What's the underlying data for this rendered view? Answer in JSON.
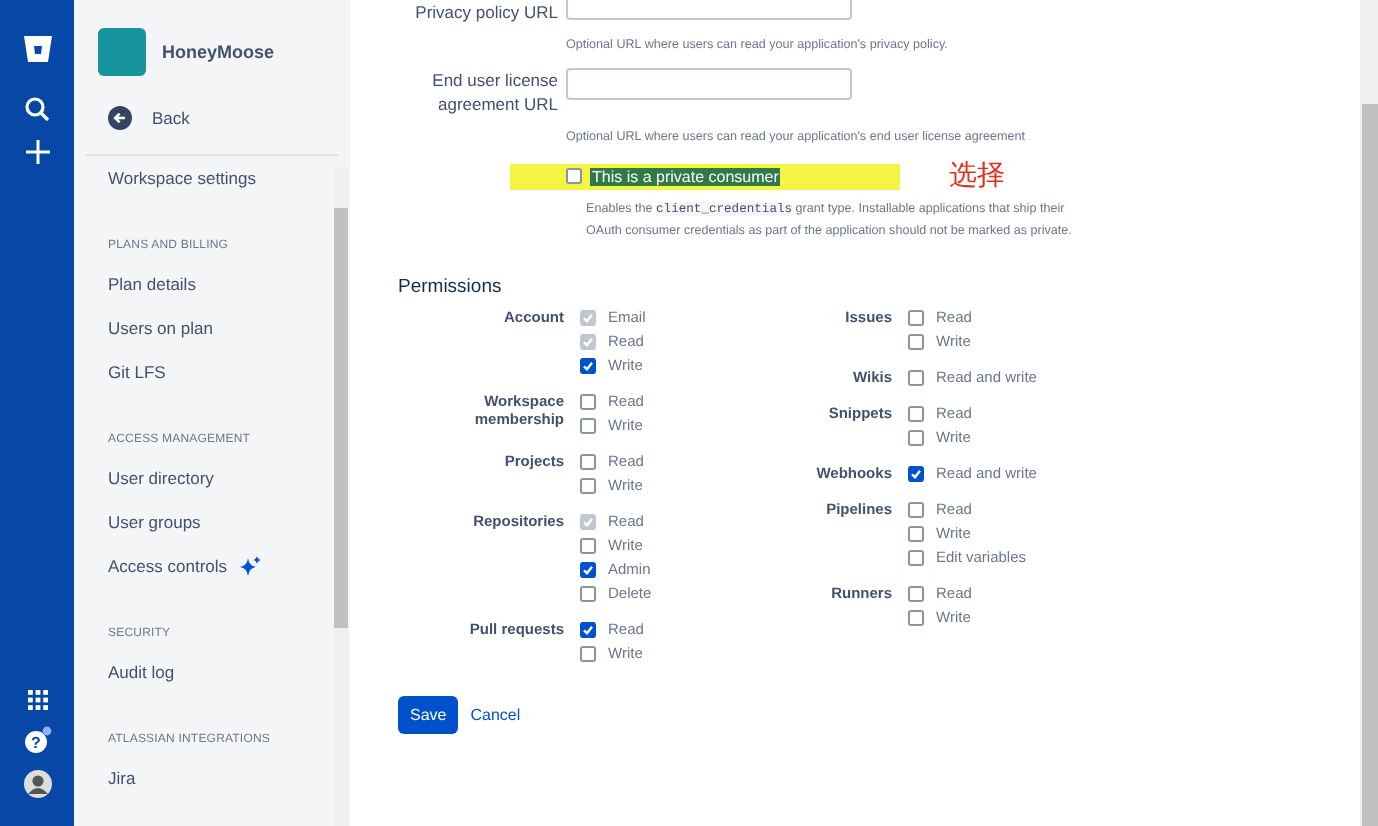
{
  "sidebar": {
    "workspace": "HoneyMoose",
    "back": "Back",
    "sections": [
      {
        "items": [
          {
            "label": "Workspace settings",
            "kind": "plain"
          }
        ]
      },
      {
        "heading": "PLANS AND BILLING",
        "items": [
          {
            "label": "Plan details",
            "kind": "plain"
          },
          {
            "label": "Users on plan",
            "kind": "plain"
          },
          {
            "label": "Git LFS",
            "kind": "plain"
          }
        ]
      },
      {
        "heading": "ACCESS MANAGEMENT",
        "items": [
          {
            "label": "User directory",
            "kind": "plain"
          },
          {
            "label": "User groups",
            "kind": "plain"
          },
          {
            "label": "Access controls",
            "kind": "new"
          }
        ]
      },
      {
        "heading": "SECURITY",
        "items": [
          {
            "label": "Audit log",
            "kind": "plain"
          }
        ]
      },
      {
        "heading": "ATLASSIAN INTEGRATIONS",
        "items": [
          {
            "label": "Jira",
            "kind": "plain"
          }
        ]
      }
    ]
  },
  "form": {
    "fields": [
      {
        "label": "Privacy policy URL",
        "hint": "Optional URL where users can read your application's privacy policy."
      },
      {
        "label": "End user license agreement URL",
        "hint": "Optional URL where users can read your application's end user license agreement"
      }
    ],
    "private_consumer": {
      "label": "This is a private consumer",
      "checked": false,
      "highlighted": true,
      "description_before": "Enables the",
      "description_code": "client_credentials",
      "description_after": "grant type. Installable applications that ship their OAuth consumer credentials as part of the application should not be marked as private."
    },
    "annotation": "选择"
  },
  "permissions": {
    "heading": "Permissions",
    "columns": [
      [
        {
          "label": "Account",
          "options": [
            {
              "label": "Email",
              "checked": true,
              "disabled": true
            },
            {
              "label": "Read",
              "checked": true,
              "disabled": true
            },
            {
              "label": "Write",
              "checked": true,
              "disabled": false
            }
          ]
        },
        {
          "label": "Workspace membership",
          "options": [
            {
              "label": "Read",
              "checked": false,
              "disabled": false
            },
            {
              "label": "Write",
              "checked": false,
              "disabled": false
            }
          ]
        },
        {
          "label": "Projects",
          "options": [
            {
              "label": "Read",
              "checked": false,
              "disabled": false
            },
            {
              "label": "Write",
              "checked": false,
              "disabled": false
            }
          ]
        },
        {
          "label": "Repositories",
          "options": [
            {
              "label": "Read",
              "checked": true,
              "disabled": true
            },
            {
              "label": "Write",
              "checked": false,
              "disabled": false
            },
            {
              "label": "Admin",
              "checked": true,
              "disabled": false
            },
            {
              "label": "Delete",
              "checked": false,
              "disabled": false
            }
          ]
        },
        {
          "label": "Pull requests",
          "options": [
            {
              "label": "Read",
              "checked": true,
              "disabled": false
            },
            {
              "label": "Write",
              "checked": false,
              "disabled": false
            }
          ]
        }
      ],
      [
        {
          "label": "Issues",
          "options": [
            {
              "label": "Read",
              "checked": false,
              "disabled": false
            },
            {
              "label": "Write",
              "checked": false,
              "disabled": false
            }
          ]
        },
        {
          "label": "Wikis",
          "options": [
            {
              "label": "Read and write",
              "checked": false,
              "disabled": false
            }
          ]
        },
        {
          "label": "Snippets",
          "options": [
            {
              "label": "Read",
              "checked": false,
              "disabled": false
            },
            {
              "label": "Write",
              "checked": false,
              "disabled": false
            }
          ]
        },
        {
          "label": "Webhooks",
          "options": [
            {
              "label": "Read and write",
              "checked": true,
              "disabled": false
            }
          ]
        },
        {
          "label": "Pipelines",
          "options": [
            {
              "label": "Read",
              "checked": false,
              "disabled": false
            },
            {
              "label": "Write",
              "checked": false,
              "disabled": false
            },
            {
              "label": "Edit variables",
              "checked": false,
              "disabled": false
            }
          ]
        },
        {
          "label": "Runners",
          "options": [
            {
              "label": "Read",
              "checked": false,
              "disabled": false
            },
            {
              "label": "Write",
              "checked": false,
              "disabled": false
            }
          ]
        }
      ]
    ]
  },
  "buttons": {
    "save": "Save",
    "cancel": "Cancel"
  },
  "rail": {
    "help": "?"
  }
}
